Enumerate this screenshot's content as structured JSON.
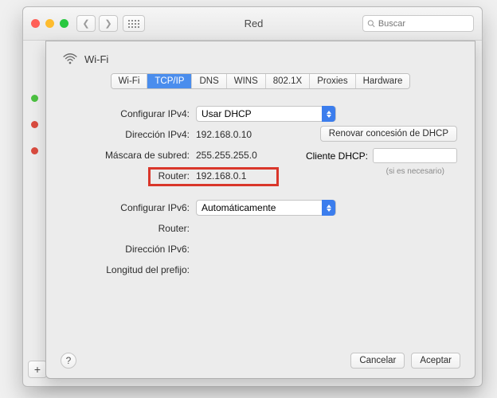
{
  "window": {
    "title": "Red",
    "search_placeholder": "Buscar"
  },
  "sidebar": {
    "add_label": "+"
  },
  "sheet": {
    "wifi_label": "Wi-Fi",
    "tabs": [
      "Wi-Fi",
      "TCP/IP",
      "DNS",
      "WINS",
      "802.1X",
      "Proxies",
      "Hardware"
    ],
    "active_tab_index": 1,
    "labels": {
      "config_ipv4": "Configurar IPv4:",
      "ipv4_addr": "Dirección IPv4:",
      "subnet": "Máscara de subred:",
      "router": "Router:",
      "config_ipv6": "Configurar IPv6:",
      "router6": "Router:",
      "ipv6_addr": "Dirección IPv6:",
      "prefix_len": "Longitud del prefijo:"
    },
    "values": {
      "config_ipv4_select": "Usar DHCP",
      "ipv4_addr": "192.168.0.10",
      "subnet": "255.255.255.0",
      "router": "192.168.0.1",
      "config_ipv6_select": "Automáticamente"
    },
    "renew_button": "Renovar concesión de DHCP",
    "dhcp_client_label": "Cliente DHCP:",
    "dhcp_hint": "(si es necesario)",
    "footer": {
      "cancel": "Cancelar",
      "ok": "Aceptar"
    }
  }
}
